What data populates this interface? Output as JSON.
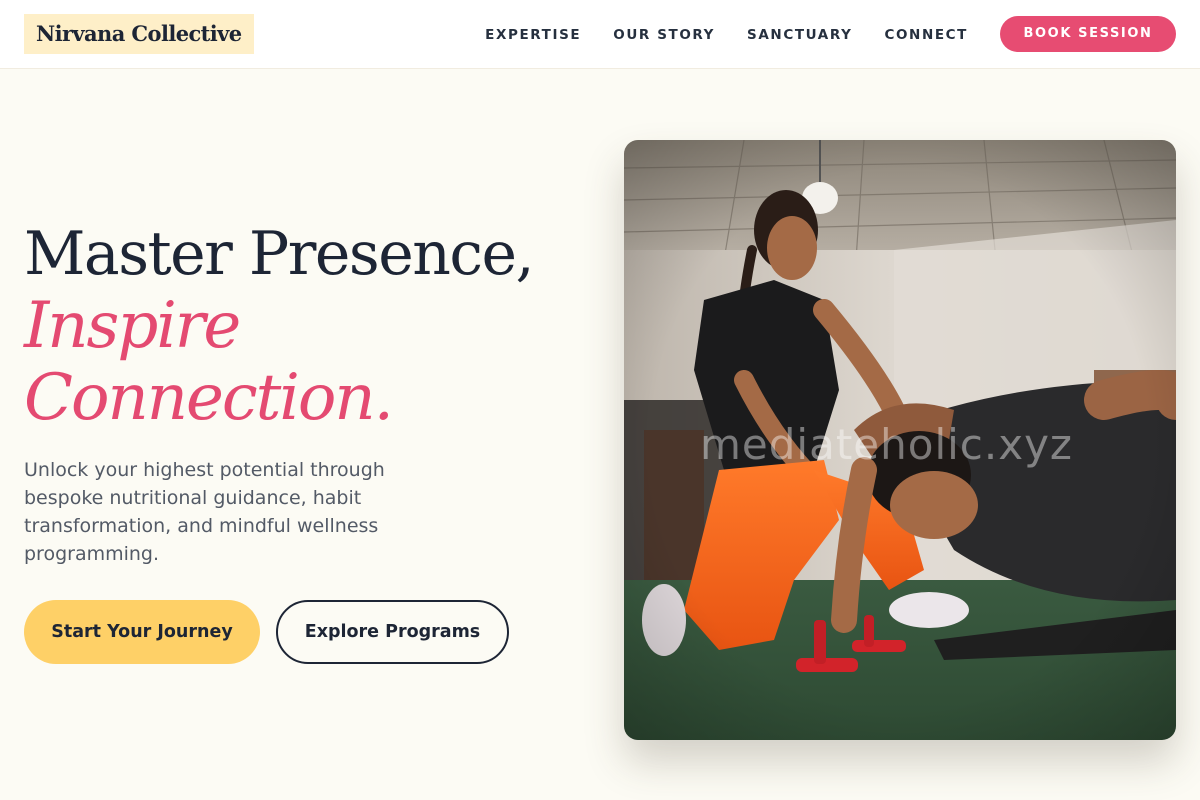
{
  "brand": {
    "name": "Nirvana Collective"
  },
  "nav": {
    "items": [
      "EXPERTISE",
      "OUR STORY",
      "SANCTUARY",
      "CONNECT"
    ],
    "cta": "BOOK SESSION"
  },
  "hero": {
    "title_line1": "Master Presence,",
    "title_line2": "Inspire",
    "title_line3": "Connection.",
    "description": "Unlock your highest potential through bespoke nutritional guidance, habit transformation, and mindful wellness programming.",
    "primary_cta": "Start Your Journey",
    "secondary_cta": "Explore Programs",
    "image_alt": "Trainer assisting a man doing push-ups in a gym"
  },
  "watermark": "mediateholic.xyz",
  "colors": {
    "accent_pink": "#e74c72",
    "accent_yellow": "#fed067",
    "logo_highlight": "#feefc8",
    "background": "#fcfbf4",
    "text_dark": "#1d2535"
  }
}
